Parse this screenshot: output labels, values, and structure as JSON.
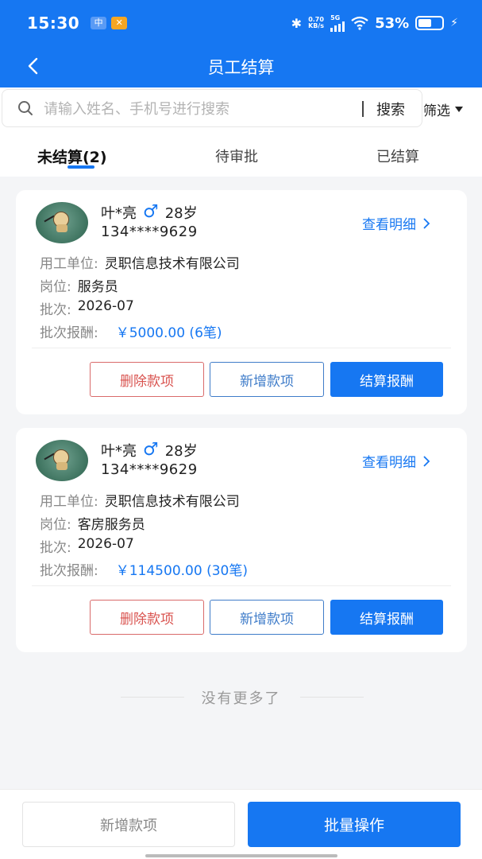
{
  "status_bar": {
    "time": "15:30",
    "speed_value": "0.70",
    "speed_unit": "KB/s",
    "network": "5G",
    "battery": "53%",
    "battery_level": 0.53
  },
  "header": {
    "title": "员工结算"
  },
  "search": {
    "placeholder": "请输入姓名、手机号进行搜索",
    "button": "搜索",
    "filter": "筛选"
  },
  "tabs": [
    {
      "label": "未结算(2)",
      "active": true
    },
    {
      "label": "待审批",
      "active": false
    },
    {
      "label": "已结算",
      "active": false
    }
  ],
  "cards": [
    {
      "name": "叶*亮",
      "gender_symbol": "♂",
      "age": "28岁",
      "phone": "134****9629",
      "detail_link": "查看明细",
      "employer_label": "用工单位:",
      "employer": "灵职信息技术有限公司",
      "position_label": "岗位:",
      "position": "服务员",
      "batch_label": "批次:",
      "batch": "2026-07",
      "pay_label": "批次报酬:",
      "pay": "￥5000.00 (6笔)",
      "btn_delete": "删除款项",
      "btn_add": "新增款项",
      "btn_settle": "结算报酬"
    },
    {
      "name": "叶*亮",
      "gender_symbol": "♂",
      "age": "28岁",
      "phone": "134****9629",
      "detail_link": "查看明细",
      "employer_label": "用工单位:",
      "employer": "灵职信息技术有限公司",
      "position_label": "岗位:",
      "position": "客房服务员",
      "batch_label": "批次:",
      "batch": "2026-07",
      "pay_label": "批次报酬:",
      "pay": "￥114500.00 (30笔)",
      "btn_delete": "删除款项",
      "btn_add": "新增款项",
      "btn_settle": "结算报酬"
    }
  ],
  "list_end": "没有更多了",
  "bottom": {
    "add": "新增款项",
    "batch": "批量操作"
  },
  "colors": {
    "primary": "#1677f2",
    "danger": "#d9534f"
  }
}
